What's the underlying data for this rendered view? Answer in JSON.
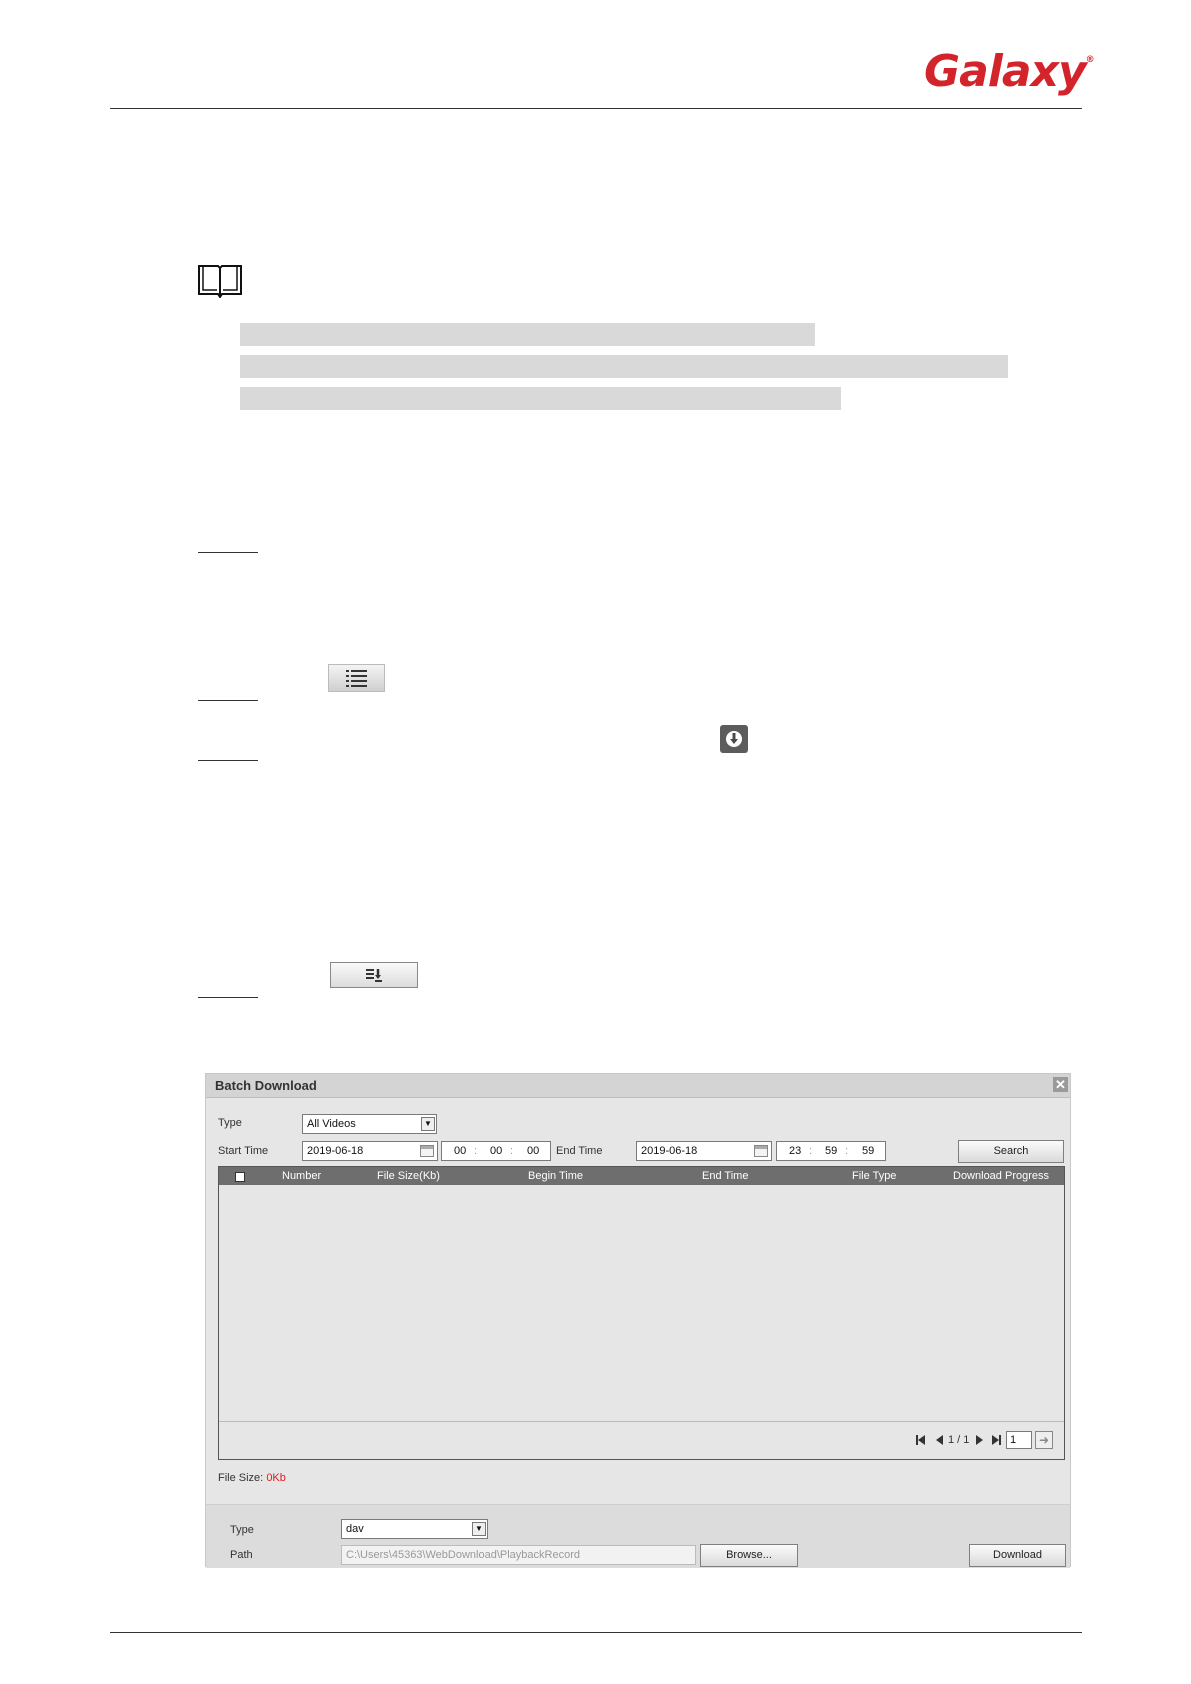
{
  "header": {
    "brand": "Galaxy",
    "registered": "®"
  },
  "dialog": {
    "title": "Batch Download",
    "close_glyph": "✕",
    "type_label": "Type",
    "type_value": "All Videos",
    "start_label": "Start Time",
    "start_date": "2019-06-18",
    "start_time": {
      "h": "00",
      "m": "00",
      "s": "00"
    },
    "end_label": "End Time",
    "end_date": "2019-06-18",
    "end_time": {
      "h": "23",
      "m": "59",
      "s": "59"
    },
    "search_label": "Search",
    "columns": [
      "Number",
      "File Size(Kb)",
      "Begin Time",
      "End Time",
      "File Type",
      "Download Progress"
    ],
    "pager": {
      "page_text": "1 / 1",
      "page_input": "1"
    },
    "file_size_label": "File Size:",
    "file_size_value": "0Kb",
    "format_label": "Type",
    "format_value": "dav",
    "path_label": "Path",
    "path_value": "C:\\Users\\45363\\WebDownload\\PlaybackRecord",
    "browse_label": "Browse...",
    "download_label": "Download"
  },
  "colors": {
    "brand": "#d3242b",
    "file_size_value": "#e21a1a",
    "header_bar": "#6e6e6e"
  }
}
